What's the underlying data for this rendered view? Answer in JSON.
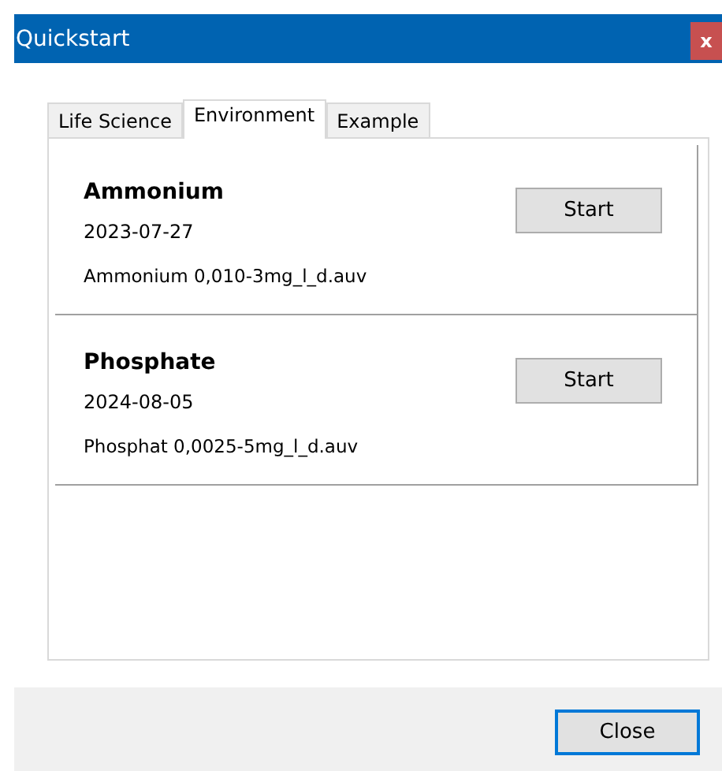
{
  "window": {
    "title": "Quickstart",
    "close_glyph": "x"
  },
  "tabs": [
    {
      "label": "Life Science",
      "selected": false
    },
    {
      "label": "Environment",
      "selected": true
    },
    {
      "label": "Example",
      "selected": false
    }
  ],
  "items": [
    {
      "name": "Ammonium",
      "date": "2023-07-27",
      "file": "Ammonium 0,010-3mg_l_d.auv",
      "button": "Start"
    },
    {
      "name": "Phosphate",
      "date": "2024-08-05",
      "file": "Phosphat 0,0025-5mg_l_d.auv",
      "button": "Start"
    }
  ],
  "footer": {
    "close_button": {
      "label": "Close",
      "focused": true
    }
  }
}
